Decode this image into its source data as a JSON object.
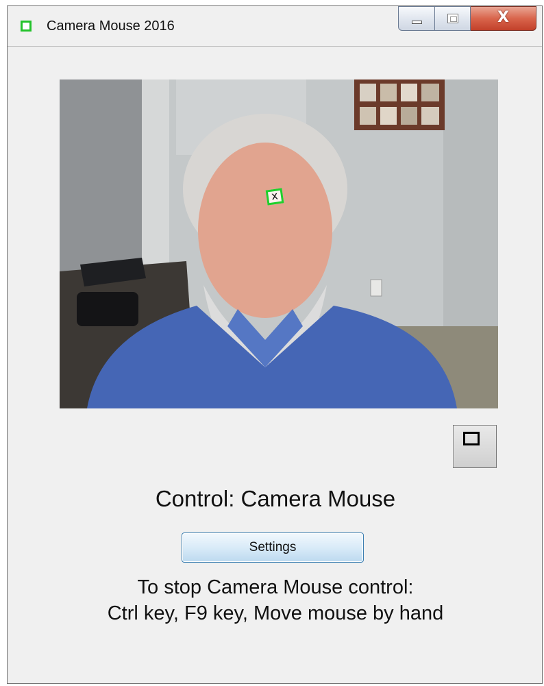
{
  "window": {
    "title": "Camera Mouse 2016",
    "caption_buttons": {
      "minimize_icon": "minimize-icon",
      "maximize_icon": "maximize-icon",
      "close_glyph": "X"
    }
  },
  "video": {
    "description_icon": "webcam-feed",
    "tracker_mark": "x",
    "tracker_color": "#1fcf2c"
  },
  "main": {
    "control_label": "Control: Camera Mouse",
    "settings_label": "Settings",
    "stop_hint_line1": "To stop Camera Mouse control:",
    "stop_hint_line2": "Ctrl key, F9 key, Move mouse by hand"
  },
  "colors": {
    "app_icon": "#22c22a",
    "close_button": "#d9654c",
    "settings_border": "#3c7fb1"
  }
}
